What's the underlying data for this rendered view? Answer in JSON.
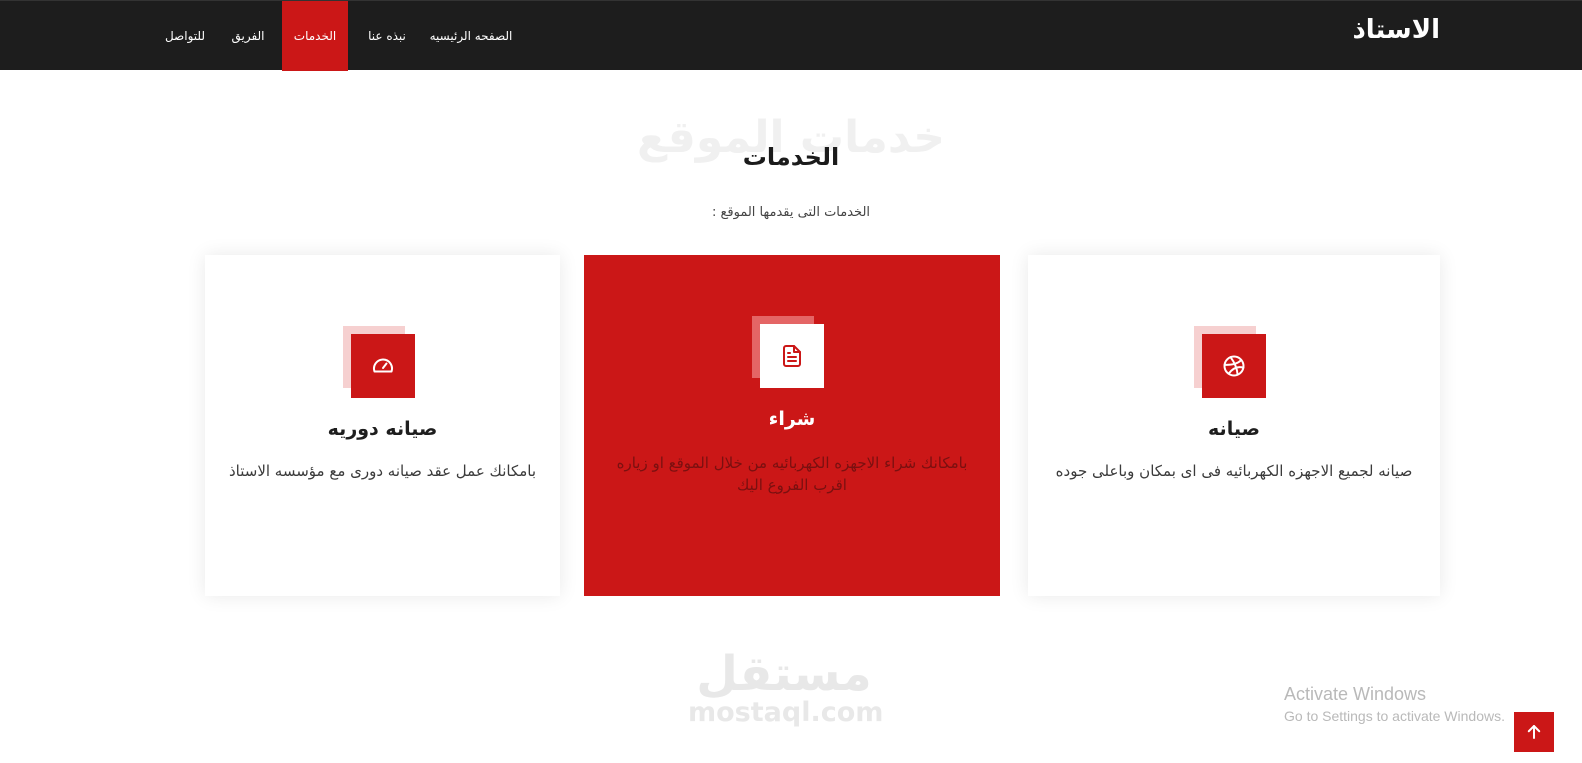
{
  "header": {
    "brand": "الاستاذ",
    "nav": [
      {
        "label": "الصفحه الرئيسيه",
        "active": false
      },
      {
        "label": "نبذه عنا",
        "active": false
      },
      {
        "label": "الخدمات",
        "active": true
      },
      {
        "label": "الفريق",
        "active": false
      },
      {
        "label": "للتواصل",
        "active": false
      }
    ]
  },
  "section": {
    "background_title": "خدمات الموقع",
    "title": "الخدمات",
    "subtitle": "الخدمات التى يقدمها الموقع :"
  },
  "cards": [
    {
      "icon": "dribbble-icon",
      "title": "صيانه",
      "text": "صيانه لجميع الاجهزه الكهربائيه فى اى بمكان وباعلى جوده"
    },
    {
      "icon": "document-icon",
      "title": "شراء",
      "text": "بامكانك شراء الاجهزه الكهربائيه من خلال الموقع او زياره اقرب الفروع اليك"
    },
    {
      "icon": "speedometer-icon",
      "title": "صيانه دوريه",
      "text": "بامكانك عمل عقد صيانه دورى مع مؤسسه الاستاذ"
    }
  ],
  "watermark": {
    "arabic": "مستقل",
    "latin": "mostaql.com"
  },
  "activation_notice": {
    "title": "Activate Windows",
    "subtitle": "Go to Settings to activate Windows."
  },
  "colors": {
    "accent": "#cb1717",
    "navbar": "#1d1d1d"
  },
  "scroll_top": {
    "icon": "arrow-up-icon"
  }
}
